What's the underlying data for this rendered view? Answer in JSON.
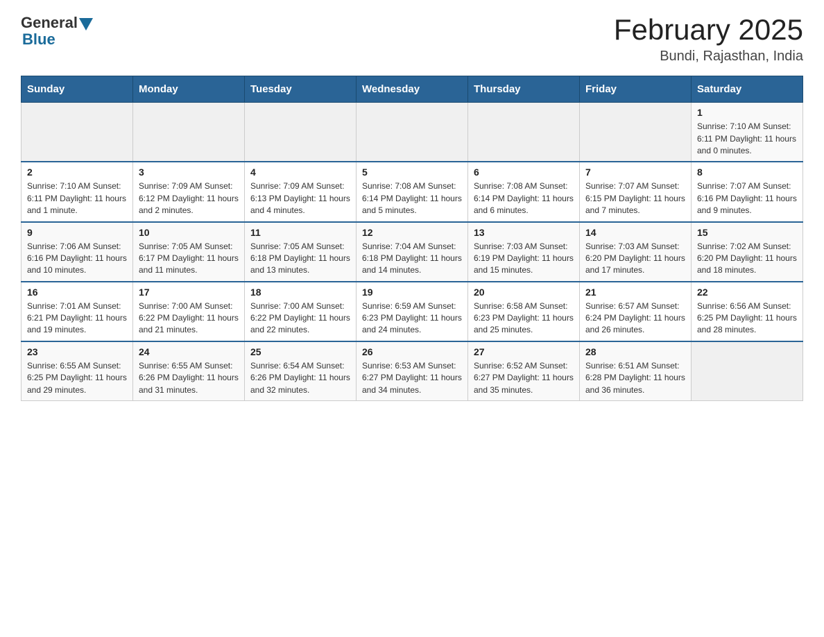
{
  "header": {
    "logo_general": "General",
    "logo_blue": "Blue",
    "month_title": "February 2025",
    "location": "Bundi, Rajasthan, India"
  },
  "days_of_week": [
    "Sunday",
    "Monday",
    "Tuesday",
    "Wednesday",
    "Thursday",
    "Friday",
    "Saturday"
  ],
  "weeks": [
    [
      {
        "day": "",
        "info": ""
      },
      {
        "day": "",
        "info": ""
      },
      {
        "day": "",
        "info": ""
      },
      {
        "day": "",
        "info": ""
      },
      {
        "day": "",
        "info": ""
      },
      {
        "day": "",
        "info": ""
      },
      {
        "day": "1",
        "info": "Sunrise: 7:10 AM\nSunset: 6:11 PM\nDaylight: 11 hours and 0 minutes."
      }
    ],
    [
      {
        "day": "2",
        "info": "Sunrise: 7:10 AM\nSunset: 6:11 PM\nDaylight: 11 hours and 1 minute."
      },
      {
        "day": "3",
        "info": "Sunrise: 7:09 AM\nSunset: 6:12 PM\nDaylight: 11 hours and 2 minutes."
      },
      {
        "day": "4",
        "info": "Sunrise: 7:09 AM\nSunset: 6:13 PM\nDaylight: 11 hours and 4 minutes."
      },
      {
        "day": "5",
        "info": "Sunrise: 7:08 AM\nSunset: 6:14 PM\nDaylight: 11 hours and 5 minutes."
      },
      {
        "day": "6",
        "info": "Sunrise: 7:08 AM\nSunset: 6:14 PM\nDaylight: 11 hours and 6 minutes."
      },
      {
        "day": "7",
        "info": "Sunrise: 7:07 AM\nSunset: 6:15 PM\nDaylight: 11 hours and 7 minutes."
      },
      {
        "day": "8",
        "info": "Sunrise: 7:07 AM\nSunset: 6:16 PM\nDaylight: 11 hours and 9 minutes."
      }
    ],
    [
      {
        "day": "9",
        "info": "Sunrise: 7:06 AM\nSunset: 6:16 PM\nDaylight: 11 hours and 10 minutes."
      },
      {
        "day": "10",
        "info": "Sunrise: 7:05 AM\nSunset: 6:17 PM\nDaylight: 11 hours and 11 minutes."
      },
      {
        "day": "11",
        "info": "Sunrise: 7:05 AM\nSunset: 6:18 PM\nDaylight: 11 hours and 13 minutes."
      },
      {
        "day": "12",
        "info": "Sunrise: 7:04 AM\nSunset: 6:18 PM\nDaylight: 11 hours and 14 minutes."
      },
      {
        "day": "13",
        "info": "Sunrise: 7:03 AM\nSunset: 6:19 PM\nDaylight: 11 hours and 15 minutes."
      },
      {
        "day": "14",
        "info": "Sunrise: 7:03 AM\nSunset: 6:20 PM\nDaylight: 11 hours and 17 minutes."
      },
      {
        "day": "15",
        "info": "Sunrise: 7:02 AM\nSunset: 6:20 PM\nDaylight: 11 hours and 18 minutes."
      }
    ],
    [
      {
        "day": "16",
        "info": "Sunrise: 7:01 AM\nSunset: 6:21 PM\nDaylight: 11 hours and 19 minutes."
      },
      {
        "day": "17",
        "info": "Sunrise: 7:00 AM\nSunset: 6:22 PM\nDaylight: 11 hours and 21 minutes."
      },
      {
        "day": "18",
        "info": "Sunrise: 7:00 AM\nSunset: 6:22 PM\nDaylight: 11 hours and 22 minutes."
      },
      {
        "day": "19",
        "info": "Sunrise: 6:59 AM\nSunset: 6:23 PM\nDaylight: 11 hours and 24 minutes."
      },
      {
        "day": "20",
        "info": "Sunrise: 6:58 AM\nSunset: 6:23 PM\nDaylight: 11 hours and 25 minutes."
      },
      {
        "day": "21",
        "info": "Sunrise: 6:57 AM\nSunset: 6:24 PM\nDaylight: 11 hours and 26 minutes."
      },
      {
        "day": "22",
        "info": "Sunrise: 6:56 AM\nSunset: 6:25 PM\nDaylight: 11 hours and 28 minutes."
      }
    ],
    [
      {
        "day": "23",
        "info": "Sunrise: 6:55 AM\nSunset: 6:25 PM\nDaylight: 11 hours and 29 minutes."
      },
      {
        "day": "24",
        "info": "Sunrise: 6:55 AM\nSunset: 6:26 PM\nDaylight: 11 hours and 31 minutes."
      },
      {
        "day": "25",
        "info": "Sunrise: 6:54 AM\nSunset: 6:26 PM\nDaylight: 11 hours and 32 minutes."
      },
      {
        "day": "26",
        "info": "Sunrise: 6:53 AM\nSunset: 6:27 PM\nDaylight: 11 hours and 34 minutes."
      },
      {
        "day": "27",
        "info": "Sunrise: 6:52 AM\nSunset: 6:27 PM\nDaylight: 11 hours and 35 minutes."
      },
      {
        "day": "28",
        "info": "Sunrise: 6:51 AM\nSunset: 6:28 PM\nDaylight: 11 hours and 36 minutes."
      },
      {
        "day": "",
        "info": ""
      }
    ]
  ]
}
